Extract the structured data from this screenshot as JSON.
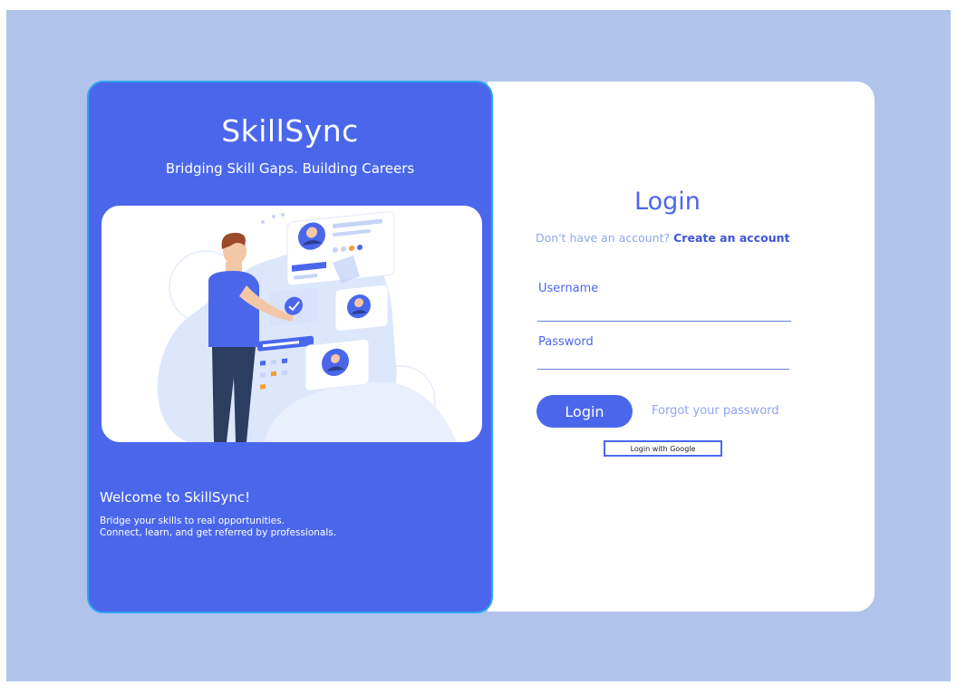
{
  "brand": {
    "title": "SkillSync",
    "tagline": "Bridging Skill Gaps. Building Careers"
  },
  "hero": {
    "illustration": "person-selecting-professional-profiles"
  },
  "welcome": {
    "heading": "Welcome to SkillSync!",
    "line1": "Bridge your skills to real opportunities.",
    "line2": "Connect, learn, and get referred by professionals."
  },
  "login": {
    "title": "Login",
    "signup_prompt": "Don't have an account?",
    "signup_link": "Create an account",
    "username_label": "Username",
    "password_label": "Password",
    "login_button": "Login",
    "forgot_link": "Forgot your password",
    "google_button": "Login with Google"
  },
  "colors": {
    "background": "#b0c4eb",
    "brand_blue": "#4a67ec",
    "panel_border": "#2fa6ee",
    "muted_text": "#8ea6ec"
  }
}
